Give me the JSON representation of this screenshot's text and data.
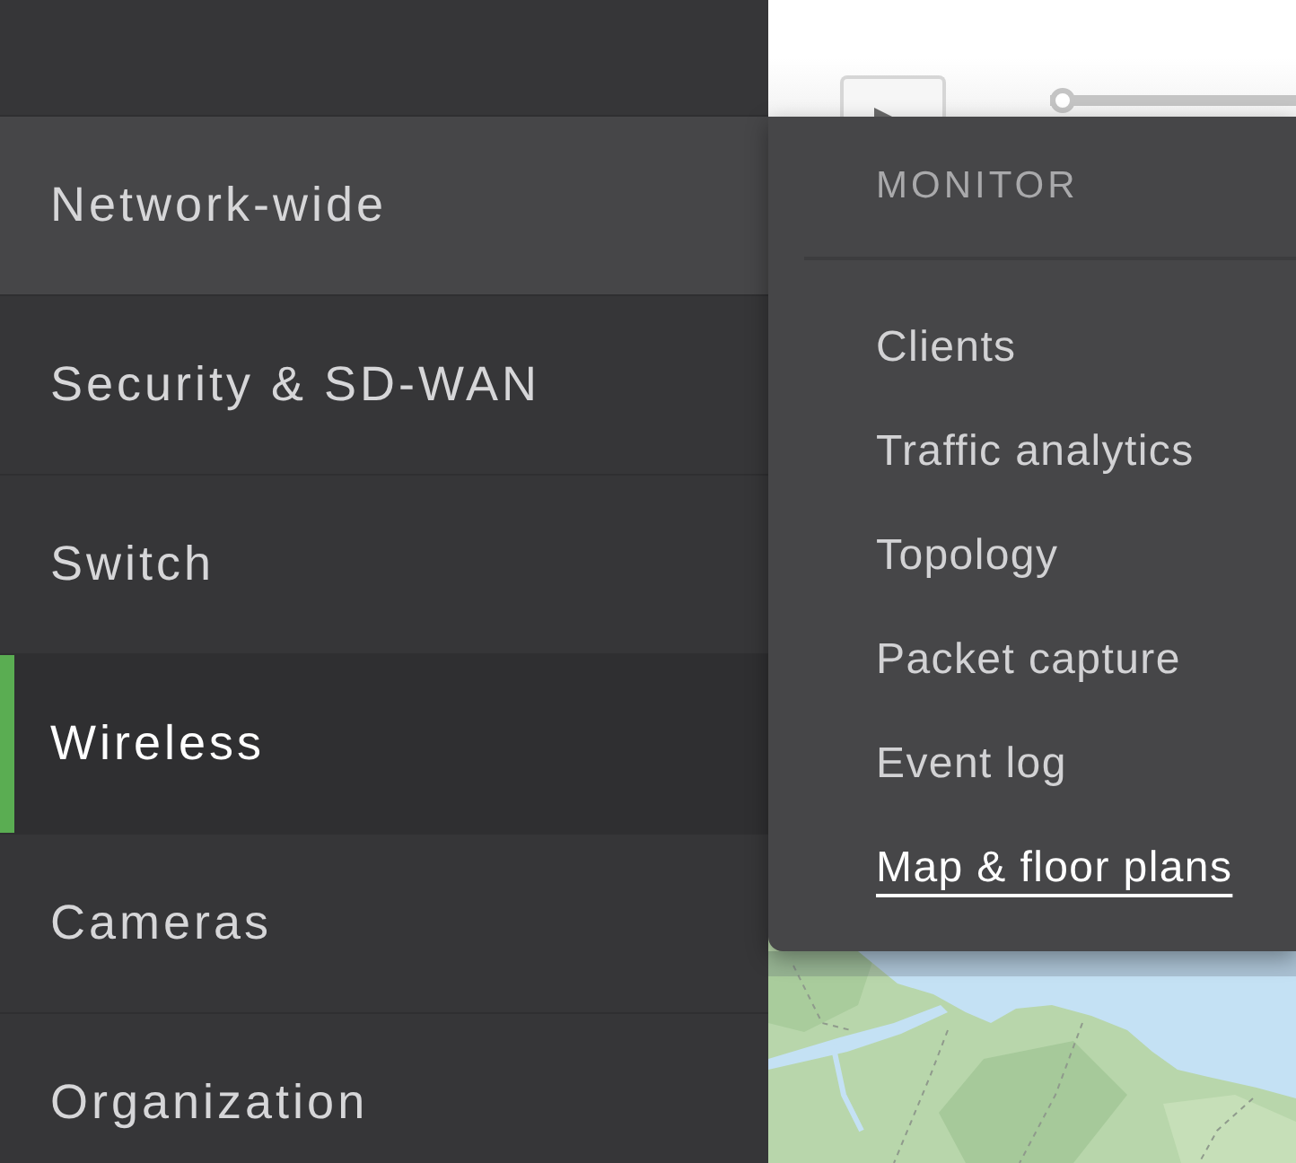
{
  "nav": {
    "items": [
      {
        "label": "Network-wide",
        "selected": false,
        "expanded": true
      },
      {
        "label": "Security & SD-WAN",
        "selected": false,
        "expanded": false
      },
      {
        "label": "Switch",
        "selected": false,
        "expanded": false
      },
      {
        "label": "Wireless",
        "selected": true,
        "expanded": false
      },
      {
        "label": "Cameras",
        "selected": false,
        "expanded": false
      },
      {
        "label": "Organization",
        "selected": false,
        "expanded": false
      }
    ]
  },
  "player": {
    "timeline": {
      "level": 0
    }
  },
  "flyout": {
    "section_title": "MONITOR",
    "items": [
      {
        "label": "Clients",
        "selected": false
      },
      {
        "label": "Traffic analytics",
        "selected": false
      },
      {
        "label": "Topology",
        "selected": false
      },
      {
        "label": "Packet capture",
        "selected": false
      },
      {
        "label": "Event log",
        "selected": false
      },
      {
        "label": "Map & floor plans",
        "selected": true
      }
    ]
  }
}
